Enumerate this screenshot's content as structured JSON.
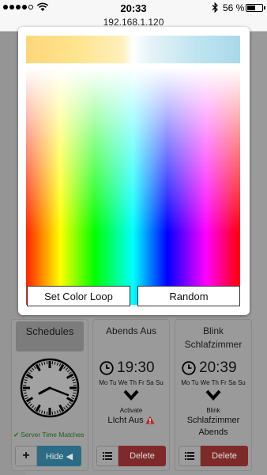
{
  "status": {
    "time": "20:33",
    "battery": "56 %",
    "battery_level": 0.56
  },
  "url": "192.168.1.120",
  "modal": {
    "buttons": {
      "color_loop": "Set Color Loop",
      "random": "Random"
    }
  },
  "cards": {
    "schedules": {
      "title": "Schedules",
      "server_status": "Server Time Matches",
      "plus": "+",
      "hide": "Hide ◀"
    },
    "abends_aus": {
      "title": "Abends Aus",
      "time": "19:30",
      "days": "Mo Tu We Th Fr Sa Su",
      "small_label": "Activate",
      "action": "LIcht Aus",
      "delete": "Delete"
    },
    "blink": {
      "title_line1": "Blink",
      "title_line2": "Schlafzimmer",
      "time": "20:39",
      "days": "Mo Tu We Th Fr Sa Su",
      "small_label": "Blink",
      "action_line1": "Schlafzimmer",
      "action_line2": "Abends",
      "delete": "Delete"
    }
  },
  "colors": {
    "warning": "#b22a2a",
    "delete": "#7f2a2a",
    "hide": "#2a6c86"
  }
}
